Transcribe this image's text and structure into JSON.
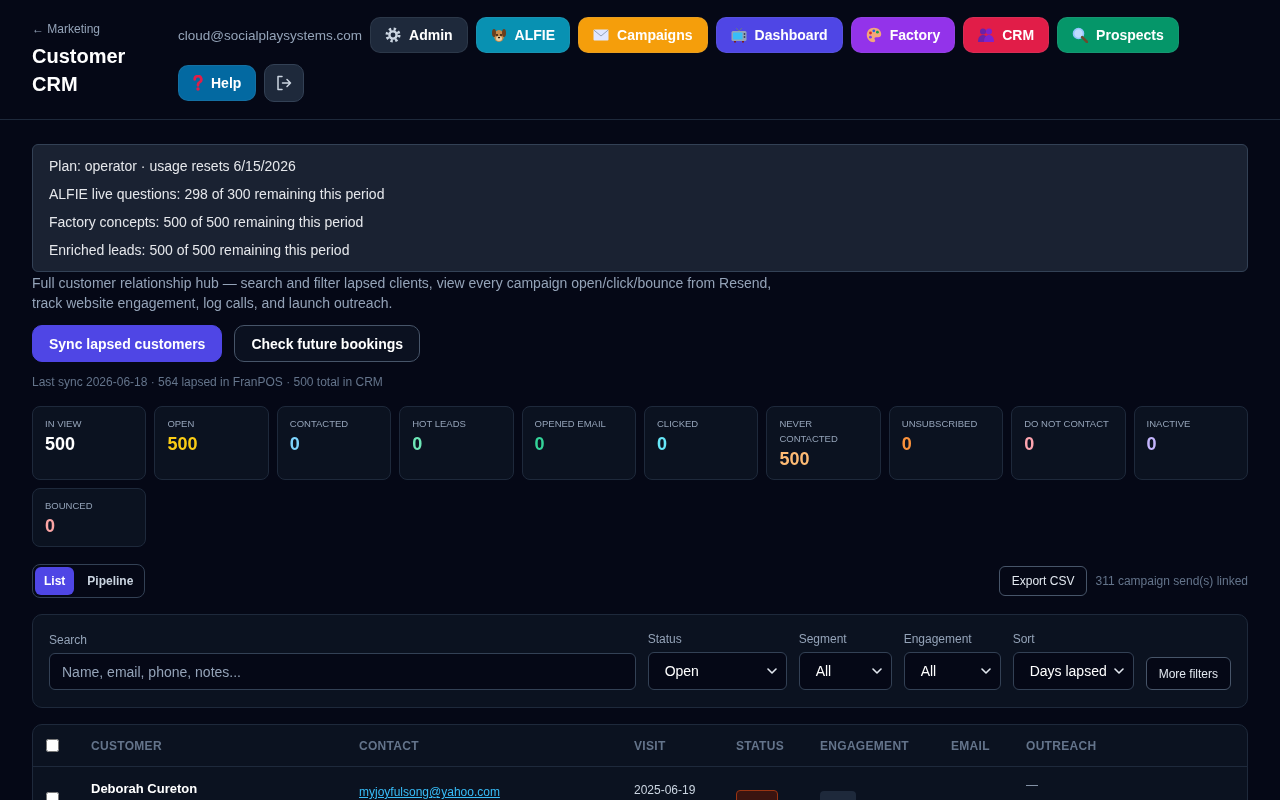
{
  "header": {
    "back_link": "← Marketing",
    "title": "Customer CRM",
    "user_email": "cloud@socialplaysystems.com",
    "nav_buttons": [
      {
        "label": "Admin",
        "color": "#1e293b"
      },
      {
        "label": "ALFIE",
        "color": "#0891b2"
      },
      {
        "label": "Campaigns",
        "color": "#f59e0b"
      },
      {
        "label": "Dashboard",
        "color": "#4f46e5"
      },
      {
        "label": "Factory",
        "color": "#9333ea"
      },
      {
        "label": "CRM",
        "color": "#e11d48"
      },
      {
        "label": "Prospects",
        "color": "#059669"
      },
      {
        "label": "Help",
        "color": "#0369a1"
      }
    ]
  },
  "plan_box": {
    "lines": [
      "Plan: operator · usage resets 6/15/2026",
      "ALFIE live questions: 298 of 300 remaining this period",
      "Factory concepts: 500 of 500 remaining this period",
      "Enriched leads: 500 of 500 remaining this period"
    ]
  },
  "description": "Full customer relationship hub — search and filter lapsed clients, view every campaign open/click/bounce from Resend, track website engagement, log calls, and launch outreach.",
  "actions": [
    {
      "label": "Sync lapsed customers",
      "kind": "primary"
    },
    {
      "label": "Check future bookings",
      "kind": "secondary"
    }
  ],
  "sync_status": "Last sync 2026-06-18 · 564 lapsed in FranPOS · 500 total in CRM",
  "stats": [
    {
      "label": "IN VIEW",
      "value": "500",
      "color": "#ffffff"
    },
    {
      "label": "OPEN",
      "value": "500",
      "color": "#facc15"
    },
    {
      "label": "CONTACTED",
      "value": "0",
      "color": "#7dd3fc"
    },
    {
      "label": "HOT LEADS",
      "value": "0",
      "color": "#6ee7b7"
    },
    {
      "label": "OPENED EMAIL",
      "value": "0",
      "color": "#34d399"
    },
    {
      "label": "CLICKED",
      "value": "0",
      "color": "#67e8f9"
    },
    {
      "label": "NEVER CONTACTED",
      "value": "500",
      "color": "#fdba74"
    },
    {
      "label": "UNSUBSCRIBED",
      "value": "0",
      "color": "#fb923c"
    },
    {
      "label": "DO NOT CONTACT",
      "value": "0",
      "color": "#fda4af"
    },
    {
      "label": "INACTIVE",
      "value": "0",
      "color": "#c4b5fd"
    },
    {
      "label": "BOUNCED",
      "value": "0",
      "color": "#fca5a5"
    }
  ],
  "view_toggle": [
    {
      "label": "List",
      "selected": true
    },
    {
      "label": "Pipeline",
      "selected": false
    }
  ],
  "export_button": "Export CSV",
  "linked_count": "311 campaign send(s) linked",
  "filters": {
    "search": {
      "label": "Search",
      "placeholder": "Name, email, phone, notes..."
    },
    "selects": [
      {
        "label": "Status",
        "value": "Open"
      },
      {
        "label": "Segment",
        "value": "All"
      },
      {
        "label": "Engagement",
        "value": "All"
      },
      {
        "label": "Sort",
        "value": "Days lapsed"
      }
    ],
    "more_button": "More filters"
  },
  "table": {
    "select_all": {
      "checked": false
    },
    "columns": [
      "CUSTOMER",
      "CONTACT",
      "VISIT",
      "STATUS",
      "ENGAGEMENT",
      "EMAIL",
      "OUTREACH"
    ],
    "rows": [
      {
        "checked": false,
        "customer": "Deborah Cureton",
        "contact": "myjoyfulsong@yahoo.com",
        "visit": "2025-06-19",
        "outreach": "—"
      }
    ]
  }
}
